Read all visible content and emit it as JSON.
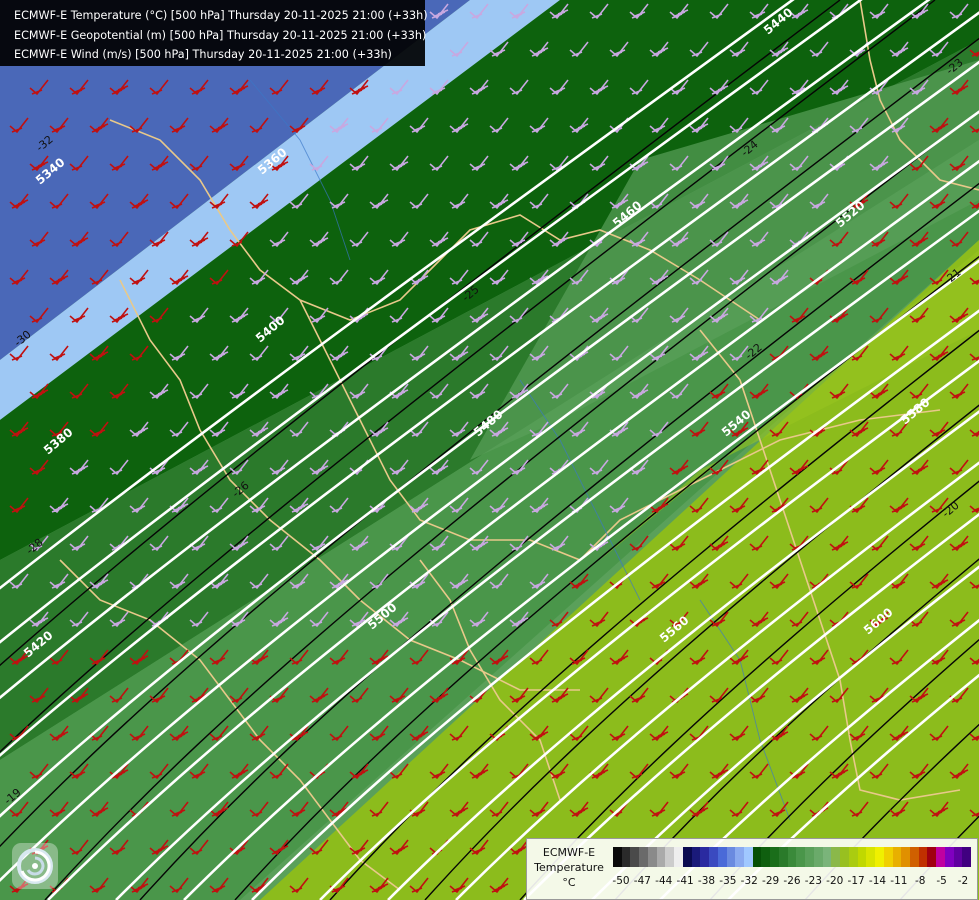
{
  "title_lines": [
    "ECMWF-E Temperature (°C) [500 hPa] Thursday 20-11-2025 21:00 (+33h)",
    "ECMWF-E Geopotential (m) [500 hPa] Thursday 20-11-2025 21:00 (+33h)",
    "ECMWF-E Wind (m/s) [500 hPa] Thursday 20-11-2025 21:00 (+33h)"
  ],
  "legend": {
    "title_model": "ECMWF-E",
    "title_var": "Temperature",
    "title_unit": "°C",
    "tick_labels": [
      "-50",
      "-47",
      "-44",
      "-41",
      "-38",
      "-35",
      "-32",
      "-29",
      "-26",
      "-23",
      "-20",
      "-17",
      "-14",
      "-11",
      "-8",
      "-5",
      "-2"
    ],
    "colors": [
      "#0a0a0a",
      "#2a2a2a",
      "#4a4a4a",
      "#6a6a6a",
      "#8a8a8a",
      "#aaaaaa",
      "#cccccc",
      "#eeeeee",
      "#0a0a50",
      "#1a1a7a",
      "#2a2aa0",
      "#3a4ac0",
      "#4a6ad8",
      "#6a8ae0",
      "#8aaaf0",
      "#a0c8ff",
      "#065006",
      "#0f5f0f",
      "#1a6e1a",
      "#2a7a2a",
      "#3a8a3a",
      "#4a964a",
      "#5aa05a",
      "#6aaa6a",
      "#7ab47a",
      "#8ab84a",
      "#98c020",
      "#aacc10",
      "#c0d800",
      "#d8e400",
      "#f0f000",
      "#f0d000",
      "#e8b000",
      "#e09000",
      "#d06000",
      "#c03000",
      "#a00010",
      "#c000a0",
      "#8000c0",
      "#6000a0",
      "#400080"
    ]
  },
  "geopotential_labels": [
    "5340",
    "5360",
    "5380",
    "5400",
    "5420",
    "5440",
    "5460",
    "5480",
    "5500",
    "5520",
    "5540",
    "5560",
    "5580",
    "5600"
  ],
  "temperature_labels": [
    "-32",
    "-30",
    "-28",
    "-26",
    "-25",
    "-24",
    "-23",
    "-22",
    "-21",
    "-20",
    "-19"
  ],
  "icons": {
    "logo": "ecmwf-swirl-logo-icon",
    "wind": "wind-barb-icon"
  }
}
